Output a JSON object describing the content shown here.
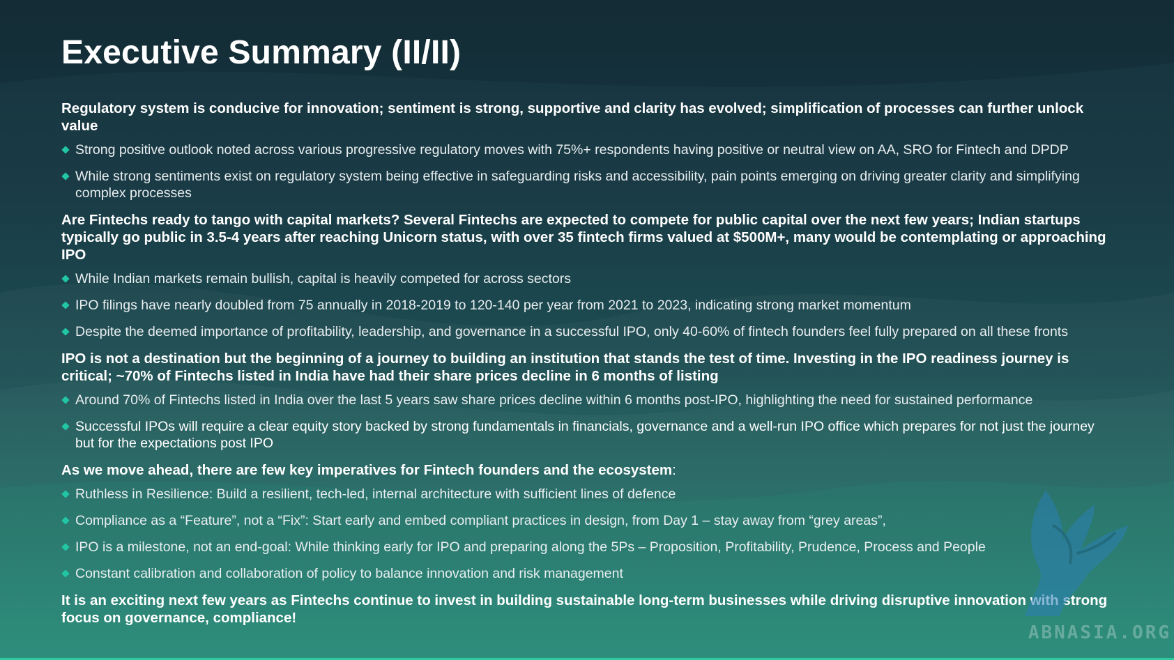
{
  "title": "Executive Summary (II/II)",
  "sections": [
    {
      "lead": "Regulatory system is conducive for innovation; sentiment is strong, supportive and clarity has evolved; simplification of processes can further unlock value",
      "bullets": [
        "Strong positive outlook noted across various progressive regulatory moves with 75%+ respondents having positive or neutral view on AA, SRO for Fintech and DPDP",
        "While strong sentiments exist on regulatory system being effective in safeguarding risks and accessibility, pain points emerging on driving greater clarity and simplifying complex processes"
      ]
    },
    {
      "lead": "Are Fintechs ready to tango with capital markets? Several Fintechs are expected to compete for public capital over the next few years; Indian startups typically go public in 3.5-4 years after reaching Unicorn status, with over 35 fintech firms valued at $500M+, many would be contemplating or approaching IPO",
      "bullets": [
        "While Indian markets remain bullish, capital is heavily competed for across sectors",
        "IPO filings have nearly doubled from 75 annually in 2018-2019 to 120-140 per year from 2021 to 2023, indicating strong market momentum",
        "Despite the deemed importance of profitability, leadership, and governance in a successful IPO, only 40-60% of fintech founders feel fully prepared on all these fronts"
      ]
    },
    {
      "lead": "IPO is not a destination but the beginning of a journey to building an institution that stands the test of time. Investing in the IPO readiness journey is critical; ~70% of Fintechs listed in India have had their share prices decline in 6 months of listing",
      "bullets": [
        "Around 70% of Fintechs listed in India over the last 5 years saw share prices decline within 6 months post-IPO, highlighting the need for sustained performance",
        "Successful IPOs will require a clear equity story backed by strong fundamentals in financials, governance and a well-run IPO office which prepares for not just the journey but for the expectations post IPO"
      ]
    },
    {
      "lead": "As we move ahead, there are few key imperatives for Fintech founders and the ecosystem",
      "lead_suffix": ":",
      "bullets": [
        "Ruthless in Resilience: Build a resilient, tech-led, internal architecture with sufficient lines of defence",
        "Compliance as a “Feature”, not a “Fix”: Start early and embed compliant practices in design, from Day 1 – stay away from “grey areas”,",
        "IPO is a milestone, not an end-goal: While thinking early for IPO and preparing along the 5Ps – Proposition, Profitability, Prudence, Process and People",
        "Constant calibration and collaboration of policy to balance innovation and risk management"
      ]
    }
  ],
  "closing": "It is an exciting next few years as Fintechs continue to invest in building sustainable long-term businesses while driving disruptive innovation with strong focus on governance, compliance!",
  "watermark": "ABNASIA.ORG",
  "colors": {
    "bullet": "#22c6a4",
    "accent_line": "#30c9a1",
    "background_top": "#16323d",
    "background_bottom": "#218573"
  }
}
